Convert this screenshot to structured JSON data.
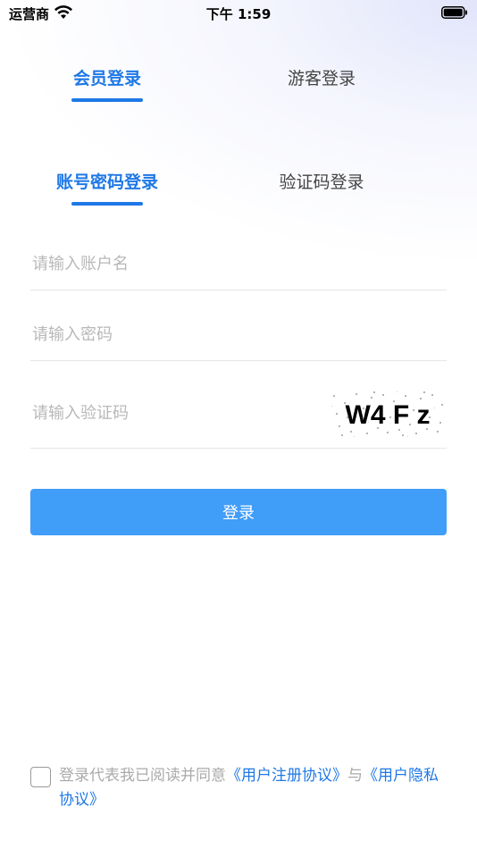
{
  "status_bar": {
    "carrier": "运营商",
    "time": "下午 1:59"
  },
  "top_tabs": [
    {
      "label": "会员登录",
      "active": true
    },
    {
      "label": "游客登录",
      "active": false
    }
  ],
  "sub_tabs": [
    {
      "label": "账号密码登录",
      "active": true
    },
    {
      "label": "验证码登录",
      "active": false
    }
  ],
  "form": {
    "account_placeholder": "请输入账户名",
    "password_placeholder": "请输入密码",
    "captcha_placeholder": "请输入验证码",
    "captcha_text": "W4 F z"
  },
  "login_button": "登录",
  "agreement": {
    "prefix": "登录代表我已阅读并同意",
    "link1": "《用户注册协议》",
    "middle": "与",
    "link2": "《用户隐私协议》"
  },
  "colors": {
    "accent": "#1e78e6",
    "button": "#409df8"
  }
}
